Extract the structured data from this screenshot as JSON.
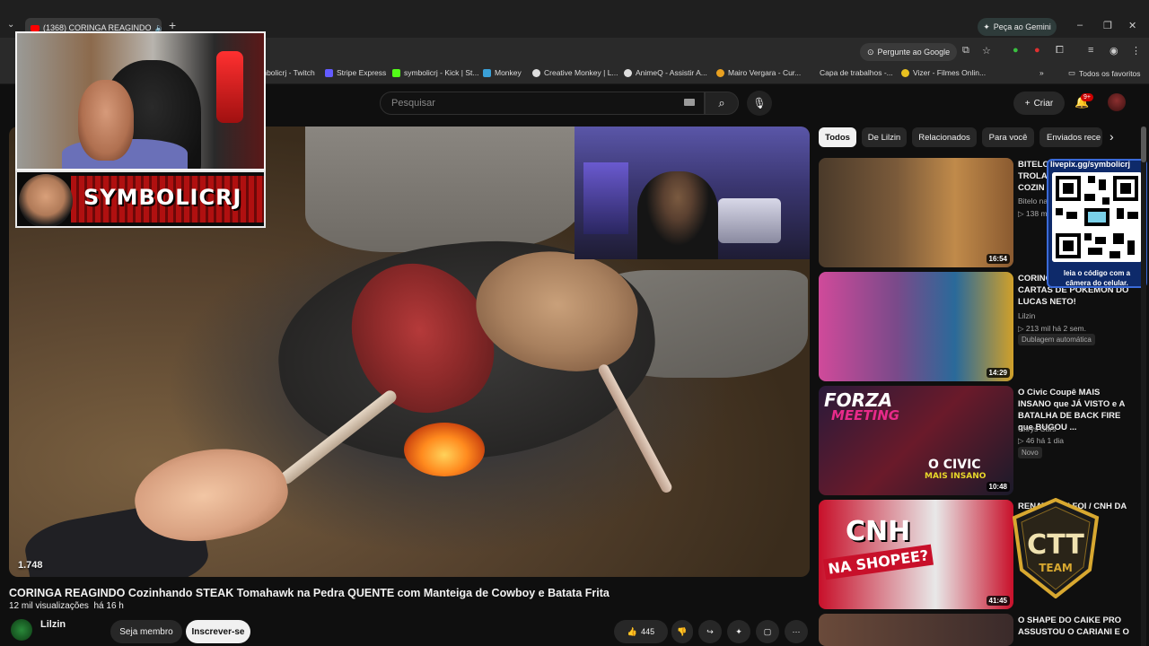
{
  "browser": {
    "tab_title": "(1368) CORINGA REAGINDO",
    "new_tab": "+",
    "gemini_label": "Peça ao Gemini",
    "ask_google_label": "Pergunte ao Google",
    "bookmarks": [
      {
        "label": "mbolicrj - Twitch",
        "color": "#9146ff"
      },
      {
        "label": "Stripe Express",
        "color": "#635bff"
      },
      {
        "label": "symbolicrj - Kick | St...",
        "color": "#53fc18"
      },
      {
        "label": "Monkey",
        "color": "#3aa0d8"
      },
      {
        "label": "Creative Monkey | L...",
        "color": "#dddddd"
      },
      {
        "label": "AnimeQ - Assistir A...",
        "color": "#dddddd"
      },
      {
        "label": "Mairo Vergara - Cur...",
        "color": "#e8a020"
      },
      {
        "label": "Capa de trabalhos -...",
        "color": "#2a2a2a"
      },
      {
        "label": "Vizer - Filmes Onlin...",
        "color": "#e8c020"
      }
    ],
    "all_bookmarks": "Todos os favoritos"
  },
  "youtube": {
    "search_placeholder": "Pesquisar",
    "create_label": "Criar",
    "notif_badge": "9+",
    "video": {
      "title": "CORINGA REAGINDO Cozinhando STEAK Tomahawk na Pedra QUENTE com Manteiga de Cowboy e Batata Frita",
      "views": "12 mil visualizações",
      "age": "há 16 h",
      "channel": "Lilzin",
      "join_label": "Seja membro",
      "subscribe_label": "Inscrever-se",
      "like_count": "445",
      "player_counter": "1.748"
    },
    "chips": [
      "Todos",
      "De Lilzin",
      "Relacionados",
      "Para você",
      "Enviados rece"
    ],
    "recommendations": [
      {
        "title": "BITELO TROLAL COZIN",
        "channel": "Bitelo na",
        "stats": "138 m",
        "duration": "16:54"
      },
      {
        "title": "CORINGA COLEÇÃO DE CARTAS DE POKÉMON DO LUCAS NETO!",
        "channel": "Lilzin",
        "stats": "213 mil  há 2 sem.",
        "badge": "Dublagem automática",
        "duration": "14:29"
      },
      {
        "title": "O Civic Coupê MAIS INSANO que JÁ VISTO e A BATALHA DE BACK FIRE que BUGOU ...",
        "channel": "Chrys Cars",
        "stats": "46  há 1 dia",
        "badge": "Novo",
        "duration": "10:48"
      },
      {
        "title": "RENAT BANI FOI / CNH DA",
        "channel": "",
        "stats": "",
        "duration": "41:45"
      },
      {
        "title": "O SHAPE DO CAIKE PRO ASSUSTOU O CARIANI E O",
        "channel": "",
        "stats": "",
        "duration": ""
      }
    ],
    "thumb_texts": {
      "forza": "FORZA",
      "meeting": "MEETING",
      "civic": "O CIVIC",
      "insano": "MAIS INSANO",
      "cnh": "CNH",
      "shopee": "NA SHOPEE?"
    }
  },
  "overlay": {
    "streamer_name": "SYMBOLICRJ",
    "qr_url": "livepix.gg/symbolicrj",
    "qr_caption": "leia o código com a câmera do celular.",
    "ctt_text": "CTT",
    "ctt_sub": "TEAM"
  }
}
